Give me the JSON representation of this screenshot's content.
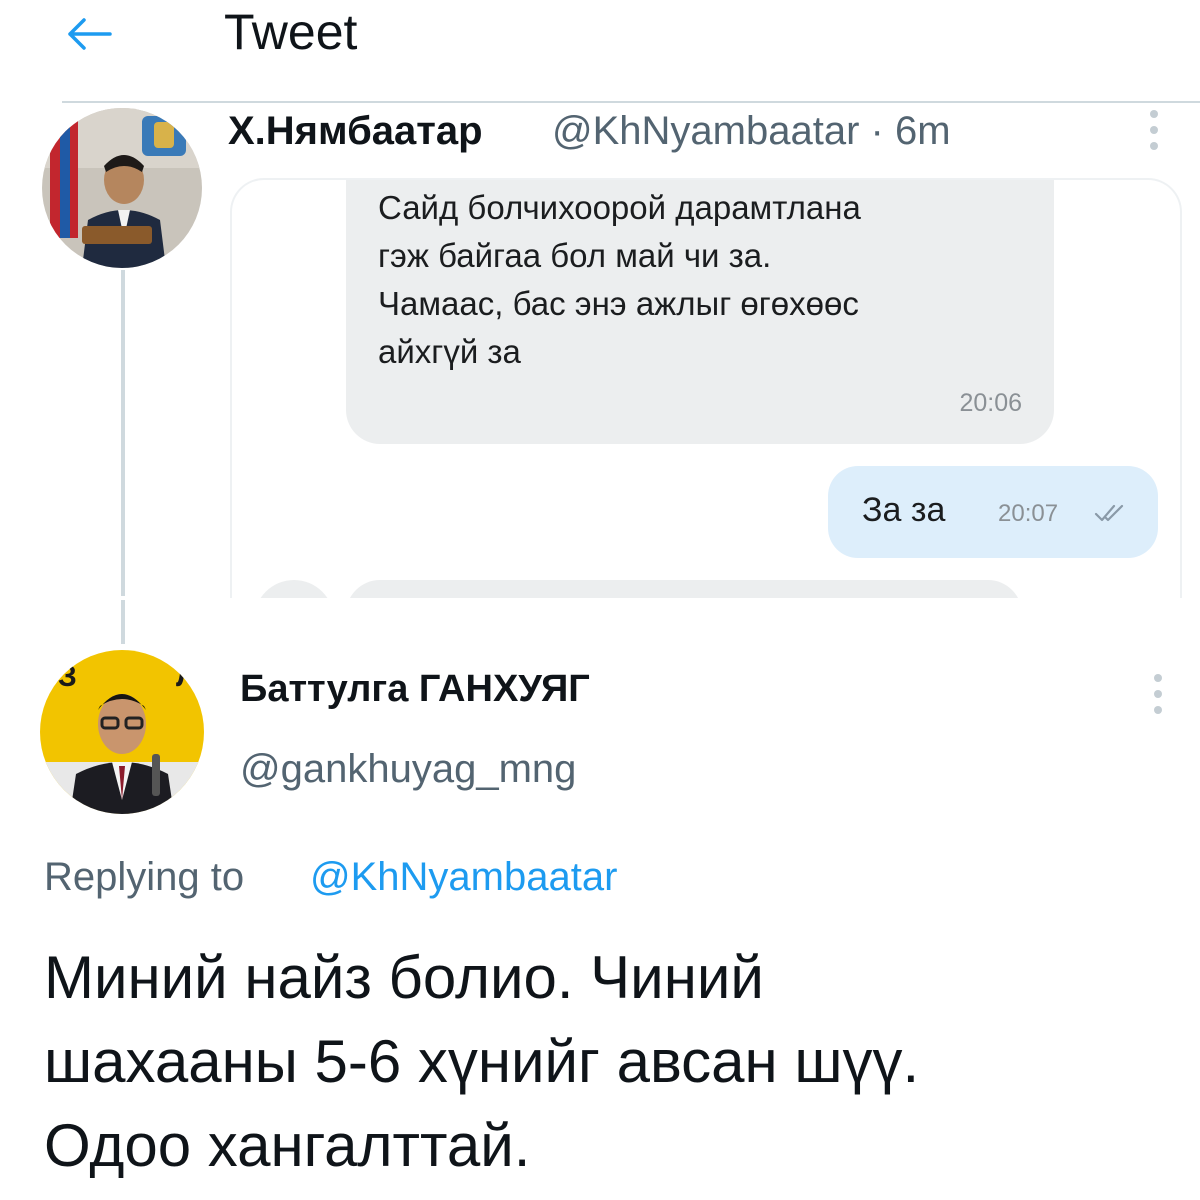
{
  "header": {
    "title": "Tweet",
    "back_icon": "arrow-left-icon"
  },
  "colors": {
    "accent": "#1d9bf0",
    "secondary_text": "#536471",
    "divider": "#cfd9de",
    "incoming_bubble": "#eceeef",
    "outgoing_bubble": "#ddeefb"
  },
  "tweet1": {
    "display_name": "Х.Нямбаатар",
    "meta": "@KhNyambaatar · 6m",
    "media": {
      "incoming_message": "Сайд болчихоорой дарамтлана\nгэж байгаа бол май чи за.\nЧамаас, бас энэ ажлыг өгөхөөс\nайхгүй за",
      "incoming_time": "20:06",
      "outgoing_message": "За за",
      "outgoing_time": "20:07"
    }
  },
  "tweet2": {
    "display_name": "Баттулга ГАНХУЯГ",
    "handle": "@gankhuyag_mng",
    "reply_prefix": "Replying to",
    "reply_to": "@KhNyambaatar",
    "text": "Миний найз болио. Чиний\nшахааны 5-6 хүнийг авсан шүү.\nОдоо хангалттай."
  }
}
